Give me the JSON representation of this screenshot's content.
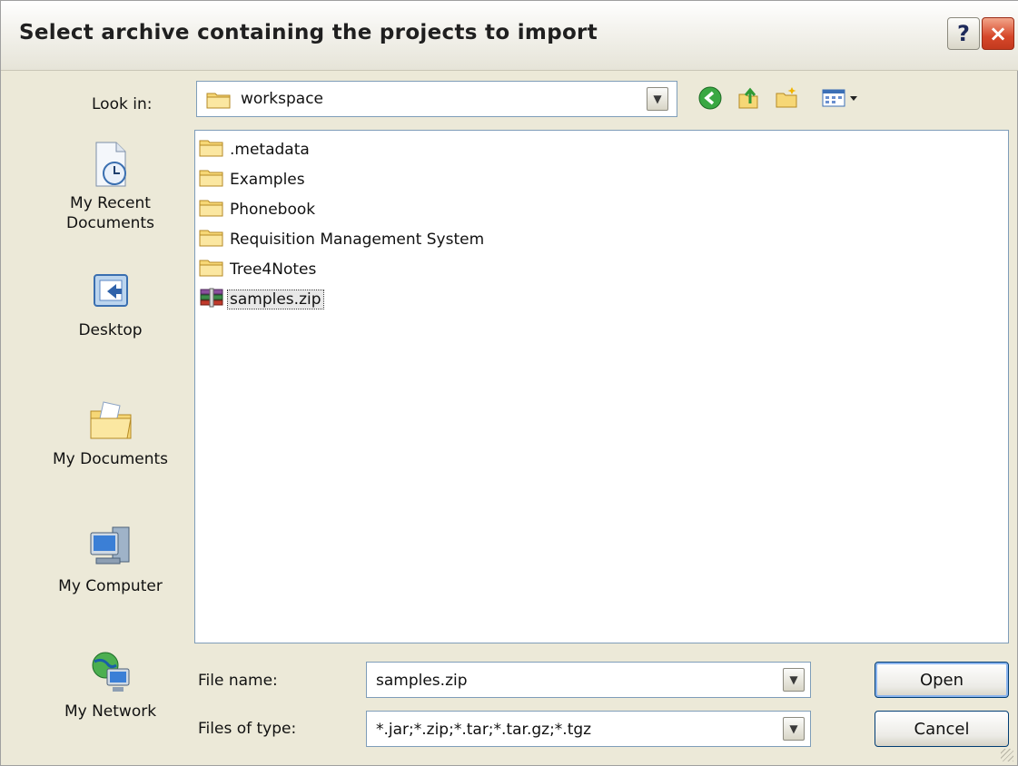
{
  "dialog": {
    "title": "Select archive containing the projects to import",
    "help_label": "?",
    "close_label": "×"
  },
  "lookin": {
    "label": "Look in:",
    "value": "workspace"
  },
  "toolbar": {
    "back_icon": "back-icon",
    "up_icon": "up-folder-icon",
    "new_folder_icon": "new-folder-icon",
    "views_icon": "views-menu-icon"
  },
  "places": [
    {
      "label": "My Recent Documents",
      "icon": "recent-documents-icon"
    },
    {
      "label": "Desktop",
      "icon": "desktop-icon"
    },
    {
      "label": "My Documents",
      "icon": "my-documents-icon"
    },
    {
      "label": "My Computer",
      "icon": "my-computer-icon"
    },
    {
      "label": "My Network",
      "icon": "my-network-icon"
    }
  ],
  "files": [
    {
      "name": ".metadata",
      "type": "folder"
    },
    {
      "name": "Examples",
      "type": "folder"
    },
    {
      "name": "Phonebook",
      "type": "folder"
    },
    {
      "name": "Requisition Management System",
      "type": "folder"
    },
    {
      "name": "Tree4Notes",
      "type": "folder"
    },
    {
      "name": "samples.zip",
      "type": "zip",
      "selected": true
    }
  ],
  "filename": {
    "label": "File name:",
    "value": "samples.zip"
  },
  "filetype": {
    "label": "Files of type:",
    "value": "*.jar;*.zip;*.tar;*.tar.gz;*.tgz"
  },
  "buttons": {
    "open": "Open",
    "cancel": "Cancel"
  },
  "colors": {
    "dialog_bg": "#ece9d8",
    "border_blue": "#7f9db9",
    "close_red": "#d6472a"
  }
}
